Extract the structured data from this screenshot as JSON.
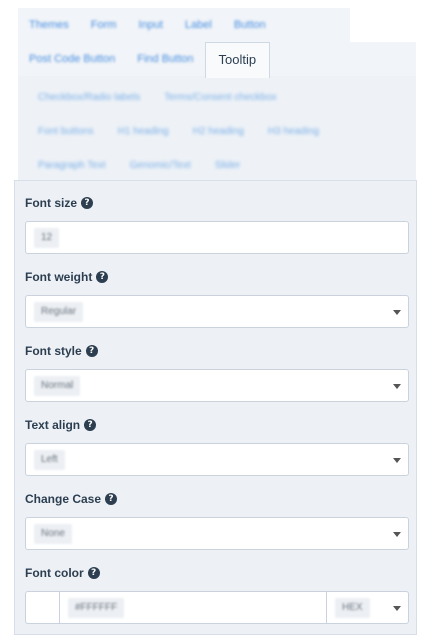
{
  "tabs": {
    "row1": [
      "Themes",
      "Form",
      "Input",
      "Label",
      "Button"
    ],
    "row2": [
      "Post Code Button",
      "Find Button",
      "Tooltip"
    ],
    "active": "Tooltip"
  },
  "subtabs": {
    "row1": [
      "Checkbox/Radio labels",
      "Terms/Consent checkbox"
    ],
    "row2": [
      "Font buttons",
      "H1 heading",
      "H2 heading",
      "H3 heading"
    ],
    "row3": [
      "Paragraph Text",
      "Genomic/Text",
      "Slider"
    ]
  },
  "form": {
    "font_size": {
      "label": "Font size",
      "value": "12"
    },
    "font_weight": {
      "label": "Font weight",
      "value": "Regular"
    },
    "font_style": {
      "label": "Font style",
      "value": "Normal"
    },
    "text_align": {
      "label": "Text align",
      "value": "Left"
    },
    "change_case": {
      "label": "Change Case",
      "value": "None"
    },
    "font_color": {
      "label": "Font color",
      "value": "#FFFFFF",
      "format": "HEX"
    }
  },
  "icons": {
    "help": "?"
  }
}
